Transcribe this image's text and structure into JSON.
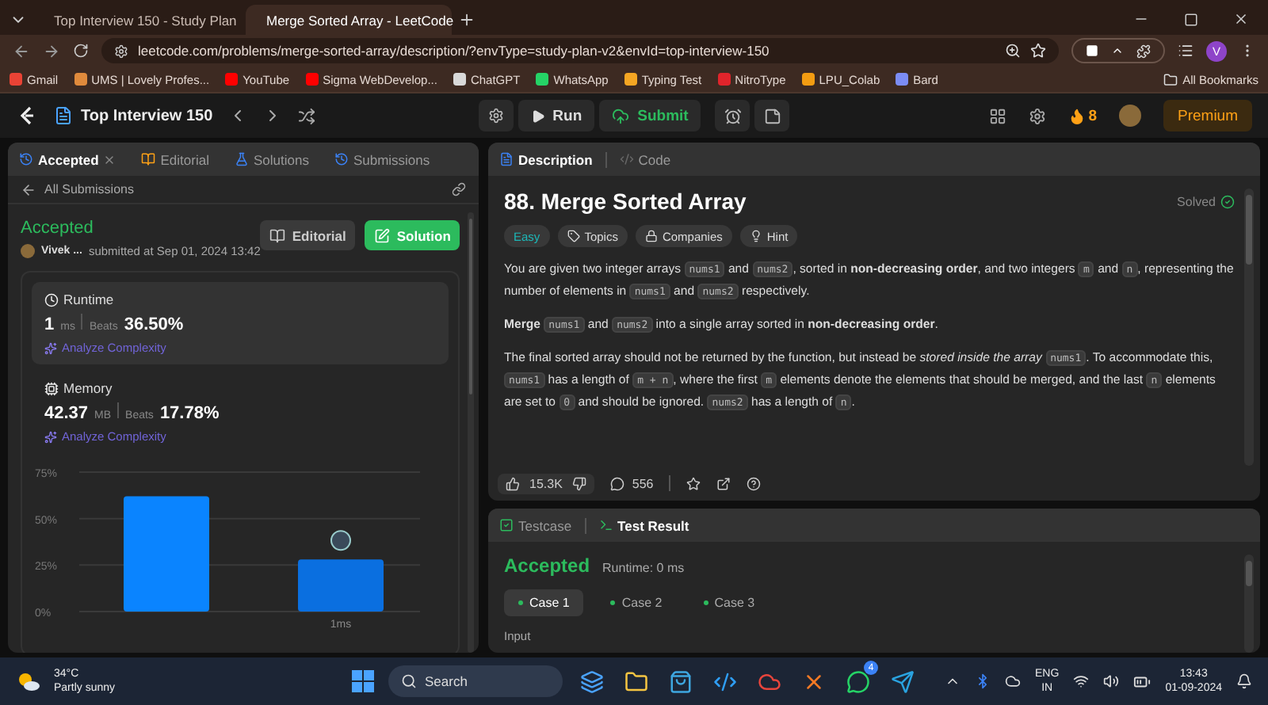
{
  "browser": {
    "tabs": [
      {
        "title": "Top Interview 150 - Study Plan",
        "selected": false
      },
      {
        "title": "Merge Sorted Array - LeetCode",
        "selected": true
      }
    ],
    "url": "leetcode.com/problems/merge-sorted-array/description/?envType=study-plan-v2&envId=top-interview-150",
    "profile": "V",
    "bookmarks": [
      {
        "label": "Gmail",
        "color": "#ea4335"
      },
      {
        "label": "UMS | Lovely Profes...",
        "color": "#e08a3c"
      },
      {
        "label": "YouTube",
        "color": "#ff0000"
      },
      {
        "label": "Sigma WebDevelop...",
        "color": "#ff0000"
      },
      {
        "label": "ChatGPT",
        "color": "#d9d9d9"
      },
      {
        "label": "WhatsApp",
        "color": "#25d366"
      },
      {
        "label": "Typing Test",
        "color": "#f5a623"
      },
      {
        "label": "NitroType",
        "color": "#e0242b"
      },
      {
        "label": "LPU_Colab",
        "color": "#f39c12"
      },
      {
        "label": "Bard",
        "color": "#7b8cf5"
      }
    ],
    "all_bookmarks": "All Bookmarks"
  },
  "nav": {
    "list_title": "Top Interview 150",
    "run": "Run",
    "submit": "Submit",
    "streak": "8",
    "premium": "Premium"
  },
  "left_panel": {
    "tabs": [
      {
        "kind": "result",
        "label": "Accepted",
        "selected": true
      },
      {
        "kind": "editorial",
        "label": "Editorial",
        "selected": false
      },
      {
        "kind": "solutions",
        "label": "Solutions",
        "selected": false
      },
      {
        "kind": "submissions",
        "label": "Submissions",
        "selected": false
      }
    ],
    "back_link": "All Submissions",
    "status": "Accepted",
    "user": "Vivek ...",
    "submitted": "submitted at Sep 01, 2024 13:42",
    "editorial_button": "Editorial",
    "solution_button": "Solution",
    "stats": [
      {
        "kind": "runtime",
        "label": "Runtime",
        "value": "1",
        "unit": "ms",
        "beats_label": "Beats",
        "beats": "36.50%",
        "analyze": "Analyze Complexity",
        "selected": true
      },
      {
        "kind": "memory",
        "label": "Memory",
        "value": "42.37",
        "unit": "MB",
        "beats_label": "Beats",
        "beats": "17.78%",
        "analyze": "Analyze Complexity",
        "selected": false
      }
    ],
    "chart_data": {
      "type": "bar",
      "categories": [
        null,
        "1ms"
      ],
      "values": [
        62,
        28
      ],
      "ylim": [
        0,
        75
      ],
      "yticks": [
        {
          "value": 0,
          "label": "0%"
        },
        {
          "value": 25,
          "label": "25%"
        },
        {
          "value": 50,
          "label": "50%"
        },
        {
          "value": 75,
          "label": "75%"
        }
      ]
    }
  },
  "description": {
    "tabs": [
      {
        "kind": "description",
        "label": "Description",
        "selected": true
      },
      {
        "kind": "code",
        "label": "Code",
        "selected": false
      }
    ],
    "title": "88. Merge Sorted Array",
    "solved": "Solved",
    "tags": [
      {
        "kind": "difficulty",
        "label": "Easy"
      },
      {
        "kind": "topics",
        "label": "Topics"
      },
      {
        "kind": "companies",
        "label": "Companies"
      },
      {
        "kind": "hint",
        "label": "Hint"
      }
    ],
    "paragraphs": [
      [
        {
          "kind": "text",
          "text": "You are given two integer arrays "
        },
        {
          "kind": "code",
          "text": "nums1"
        },
        {
          "kind": "text",
          "text": " and "
        },
        {
          "kind": "code",
          "text": "nums2"
        },
        {
          "kind": "text",
          "text": ", sorted in **non-decreasing order**, and two integers "
        },
        {
          "kind": "code",
          "text": "m"
        },
        {
          "kind": "text",
          "text": " and "
        },
        {
          "kind": "code",
          "text": "n"
        },
        {
          "kind": "text",
          "text": ", representing the number of elements in "
        },
        {
          "kind": "code",
          "text": "nums1"
        },
        {
          "kind": "text",
          "text": " and "
        },
        {
          "kind": "code",
          "text": "nums2"
        },
        {
          "kind": "text",
          "text": " respectively."
        }
      ],
      [
        {
          "kind": "text",
          "text": "**Merge** "
        },
        {
          "kind": "code",
          "text": "nums1"
        },
        {
          "kind": "text",
          "text": " and "
        },
        {
          "kind": "code",
          "text": "nums2"
        },
        {
          "kind": "text",
          "text": " into a single array sorted in **non-decreasing order**."
        }
      ],
      [
        {
          "kind": "text",
          "text": "The final sorted array should not be returned by the function, but instead be *stored inside the array* "
        },
        {
          "kind": "code",
          "text": "nums1"
        },
        {
          "kind": "text",
          "text": ". To accommodate this, "
        },
        {
          "kind": "code",
          "text": "nums1"
        },
        {
          "kind": "text",
          "text": " has a length of "
        },
        {
          "kind": "code",
          "text": "m + n"
        },
        {
          "kind": "text",
          "text": ", where the first "
        },
        {
          "kind": "code",
          "text": "m"
        },
        {
          "kind": "text",
          "text": " elements denote the elements that should be merged, and the last "
        },
        {
          "kind": "code",
          "text": "n"
        },
        {
          "kind": "text",
          "text": " elements are set to "
        },
        {
          "kind": "code",
          "text": "0"
        },
        {
          "kind": "text",
          "text": " and should be ignored. "
        },
        {
          "kind": "code",
          "text": "nums2"
        },
        {
          "kind": "text",
          "text": " has a length of "
        },
        {
          "kind": "code",
          "text": "n"
        },
        {
          "kind": "text",
          "text": "."
        }
      ]
    ],
    "likes": "15.3K",
    "comments": "556"
  },
  "result_panel": {
    "tabs": [
      {
        "kind": "testcase",
        "label": "Testcase",
        "selected": false
      },
      {
        "kind": "result",
        "label": "Test Result",
        "selected": true
      }
    ],
    "status": "Accepted",
    "runtime": "Runtime: 0 ms",
    "cases": [
      {
        "label": "Case 1",
        "selected": true
      },
      {
        "label": "Case 2",
        "selected": false
      },
      {
        "label": "Case 3",
        "selected": false
      }
    ],
    "input_label": "Input"
  },
  "taskbar": {
    "temperature": "34°C",
    "weather": "Partly sunny",
    "search": "Search",
    "apps": [
      {
        "kind": "windows"
      },
      {
        "kind": "folder"
      },
      {
        "kind": "store"
      },
      {
        "kind": "code"
      },
      {
        "kind": "browser"
      },
      {
        "kind": "xampp"
      },
      {
        "kind": "chat",
        "badge": "4"
      },
      {
        "kind": "send"
      }
    ],
    "language": "ENG",
    "region": "IN",
    "time": "13:43",
    "date": "01-09-2024"
  }
}
